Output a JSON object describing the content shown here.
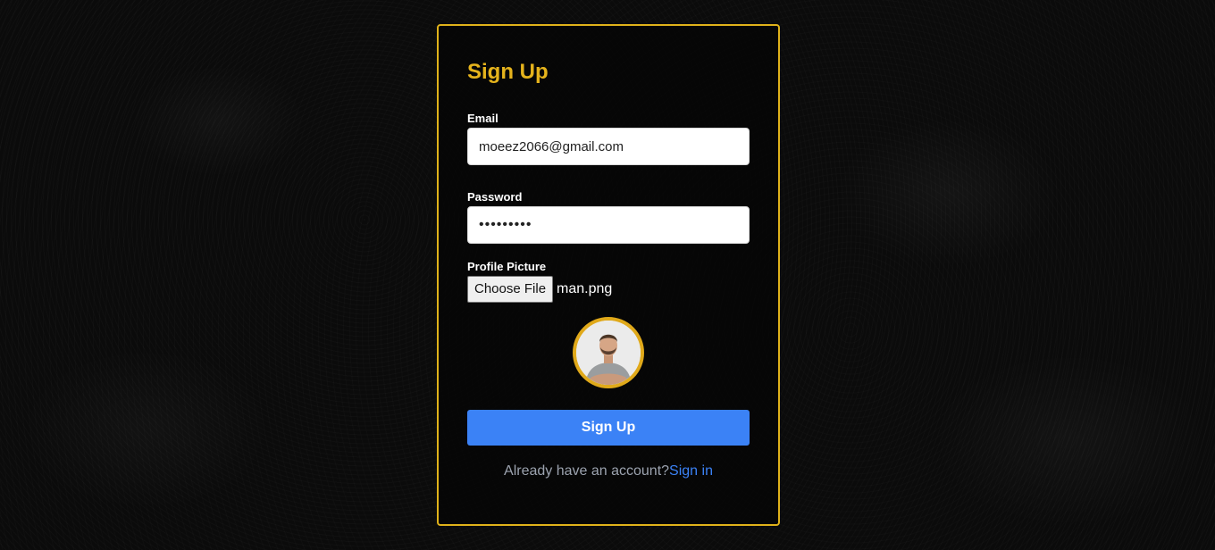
{
  "form": {
    "title": "Sign Up",
    "email_label": "Email",
    "email_value": "moeez2066@gmail.com",
    "password_label": "Password",
    "password_masked": "•••••••••",
    "picture_label": "Profile Picture",
    "choose_file_label": "Choose File",
    "file_name": "man.png",
    "submit_label": "Sign Up",
    "footer_text": "Already have an account?",
    "signin_link": "Sign in"
  },
  "colors": {
    "accent": "#e0b21a",
    "primary_button": "#3b82f6",
    "link": "#3b82f6",
    "background": "#0b0b0b"
  },
  "icons": {
    "avatar": "profile-photo-man"
  }
}
